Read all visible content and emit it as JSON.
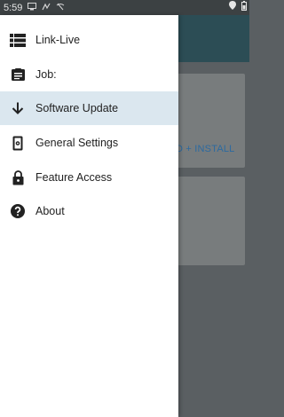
{
  "status_bar": {
    "time": "5:59",
    "icons": [
      "monitor-icon",
      "signal-icon",
      "no-wifi-icon"
    ],
    "right_icons": [
      "location-icon",
      "battery-icon"
    ]
  },
  "background": {
    "action_label": "D + INSTALL",
    "toolbar_color": "#2c4d55",
    "action_color": "#2c6aa0"
  },
  "drawer": {
    "items": [
      {
        "label": "Link-Live",
        "icon": "list-icon",
        "active": false
      },
      {
        "label": "Job:",
        "icon": "clipboard-icon",
        "active": false
      },
      {
        "label": "Software Update",
        "icon": "arrow-down-icon",
        "active": true
      },
      {
        "label": "General Settings",
        "icon": "settings-device-icon",
        "active": false
      },
      {
        "label": "Feature Access",
        "icon": "lock-icon",
        "active": false
      },
      {
        "label": "About",
        "icon": "help-icon",
        "active": false
      }
    ],
    "active_color": "#dbe7ef"
  }
}
